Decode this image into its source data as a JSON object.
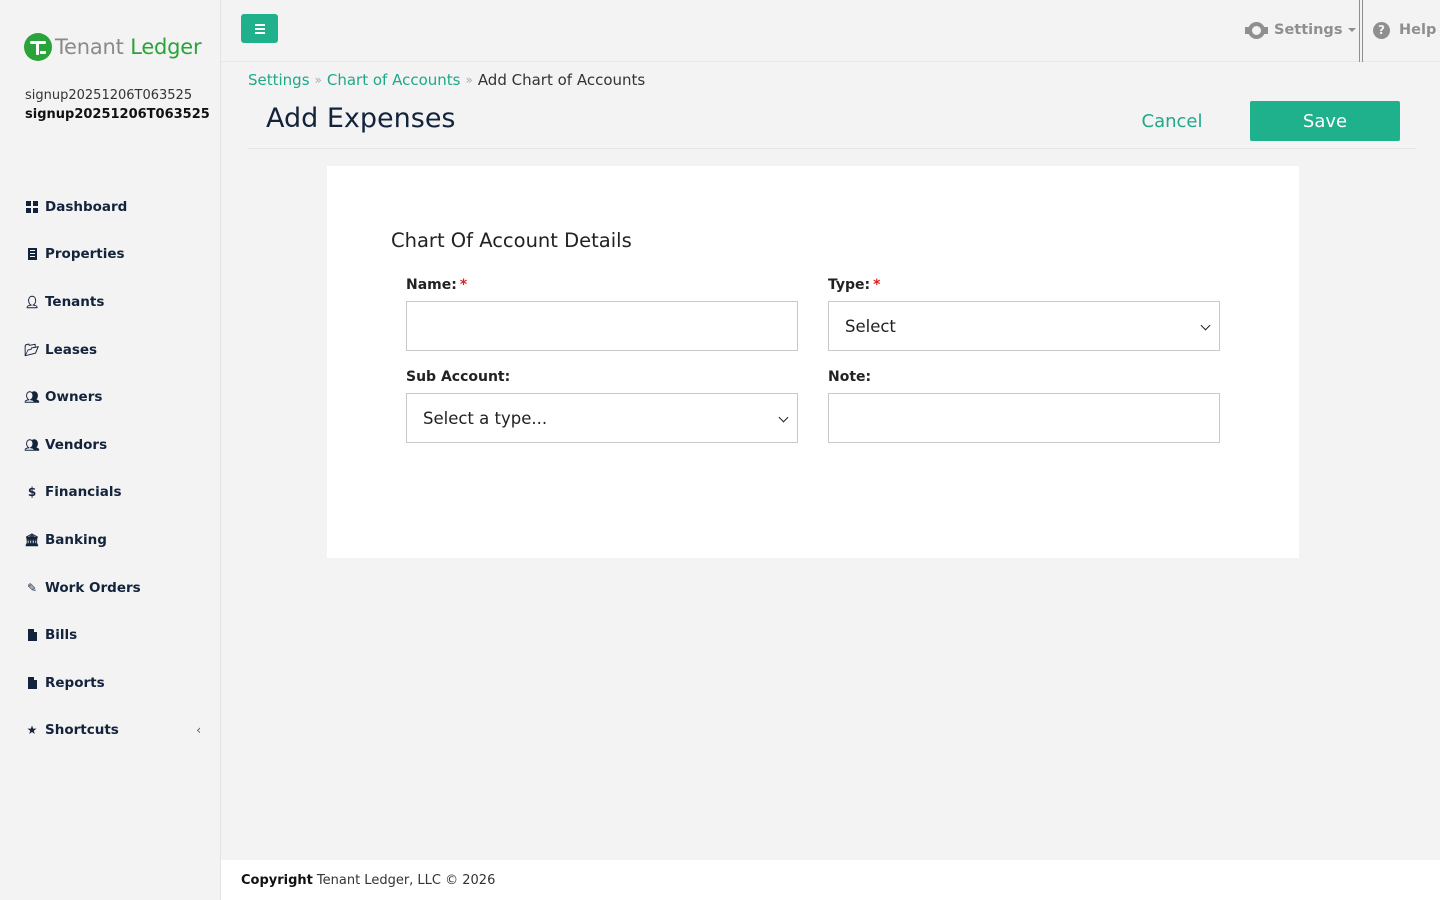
{
  "brand": {
    "name_part1": "Tenant",
    "name_part2": "Ledger",
    "gray_color": "#8a8a8a",
    "green_color": "#2aa33a"
  },
  "user": {
    "line1": "signup20251206T063525",
    "line2": "signup20251206T063525"
  },
  "sidebar": {
    "items": [
      {
        "label": "Dashboard",
        "icon": "dashboard-icon"
      },
      {
        "label": "Properties",
        "icon": "building-icon"
      },
      {
        "label": "Tenants",
        "icon": "user-icon"
      },
      {
        "label": "Leases",
        "icon": "folder-open-icon"
      },
      {
        "label": "Owners",
        "icon": "users-icon"
      },
      {
        "label": "Vendors",
        "icon": "users-icon"
      },
      {
        "label": "Financials",
        "icon": "dollar-icon"
      },
      {
        "label": "Banking",
        "icon": "bank-icon"
      },
      {
        "label": "Work Orders",
        "icon": "edit-icon"
      },
      {
        "label": "Bills",
        "icon": "file-icon"
      },
      {
        "label": "Reports",
        "icon": "file-icon"
      },
      {
        "label": "Shortcuts",
        "icon": "star-icon"
      }
    ]
  },
  "topbar": {
    "settings_label": "Settings",
    "help_label": "Help"
  },
  "breadcrumb": {
    "items": [
      "Settings",
      "Chart of Accounts"
    ],
    "current": "Add Chart of Accounts"
  },
  "page": {
    "title": "Add Expenses",
    "cancel_label": "Cancel",
    "save_label": "Save"
  },
  "form": {
    "section_title": "Chart Of Account Details",
    "name_label": "Name:",
    "name_value": "",
    "type_label": "Type:",
    "type_value": "Select",
    "sub_account_label": "Sub Account:",
    "sub_account_value": "Select a type...",
    "note_label": "Note:",
    "note_value": "",
    "required_mark": "*"
  },
  "footer": {
    "bold": "Copyright",
    "text": "Tenant Ledger, LLC © 2026"
  },
  "colors": {
    "accent": "#1fb08c",
    "link": "#1fa889",
    "nav_text": "#14233c",
    "required": "#e02020"
  }
}
